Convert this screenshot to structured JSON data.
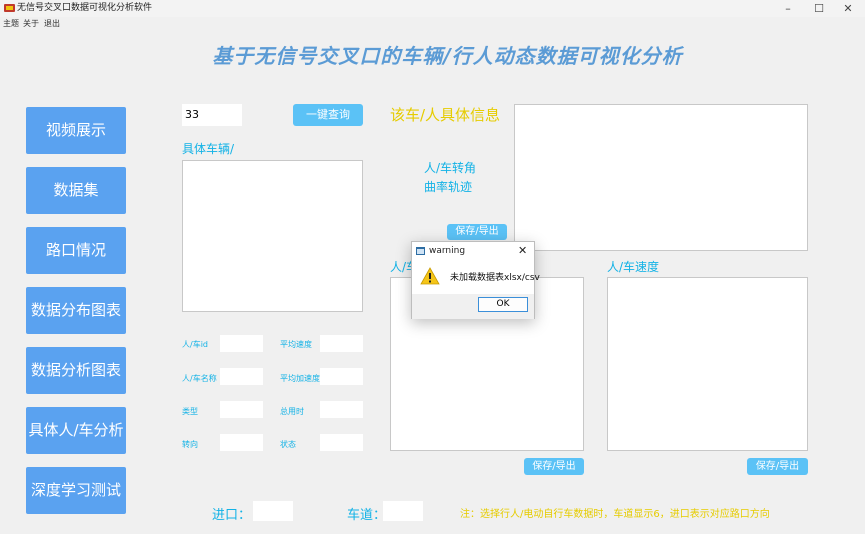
{
  "window": {
    "title": "无信号交叉口数据可视化分析软件",
    "minimize": "–",
    "maximize": "☐",
    "close": "✕"
  },
  "menu": [
    "主题",
    "关于",
    "退出"
  ],
  "header": {
    "title": "基于无信号交叉口的车辆/行人动态数据可视化分析"
  },
  "nav": [
    "视频展示",
    "数据集",
    "路口情况",
    "数据分布图表",
    "数据分析图表",
    "具体人/车分析",
    "深度学习测试"
  ],
  "query": {
    "value": "33",
    "button": "一键查询"
  },
  "vehicle_list": {
    "label": "具体车辆/"
  },
  "fields": [
    {
      "label": "人/车id",
      "value": ""
    },
    {
      "label": "平均速度",
      "value": ""
    },
    {
      "label": "人/车名称",
      "value": ""
    },
    {
      "label": "平均加速度",
      "value": ""
    },
    {
      "label": "类型",
      "value": ""
    },
    {
      "label": "总用时",
      "value": ""
    },
    {
      "label": "转向",
      "value": ""
    },
    {
      "label": "状态",
      "value": ""
    }
  ],
  "info_panel": {
    "label": "该车/人具体信息"
  },
  "turn_panel": {
    "label_line1": "人/车转角",
    "label_line2": "曲率轨迹",
    "save": "保存/导出"
  },
  "trajectory_panel": {
    "label": "人/车",
    "save": "保存/导出"
  },
  "speed_panel": {
    "label": "人/车速度",
    "save": "保存/导出"
  },
  "bottom": {
    "entrance_label": "进口：",
    "lane_label": "车道：",
    "note": "注：选择行人/电动自行车数据时，车道显示6，进口表示对应路口方向"
  },
  "dialog": {
    "title": "warning",
    "message": "未加载数据表xlsx/csv",
    "ok": "OK",
    "close": "✕"
  },
  "colors": {
    "nav_button": "#5aa2f0",
    "title": "#5b9bd5",
    "cyan_text": "#12b2e6",
    "yellow_text": "#e6cc00",
    "small_button": "#5bc2f6"
  }
}
